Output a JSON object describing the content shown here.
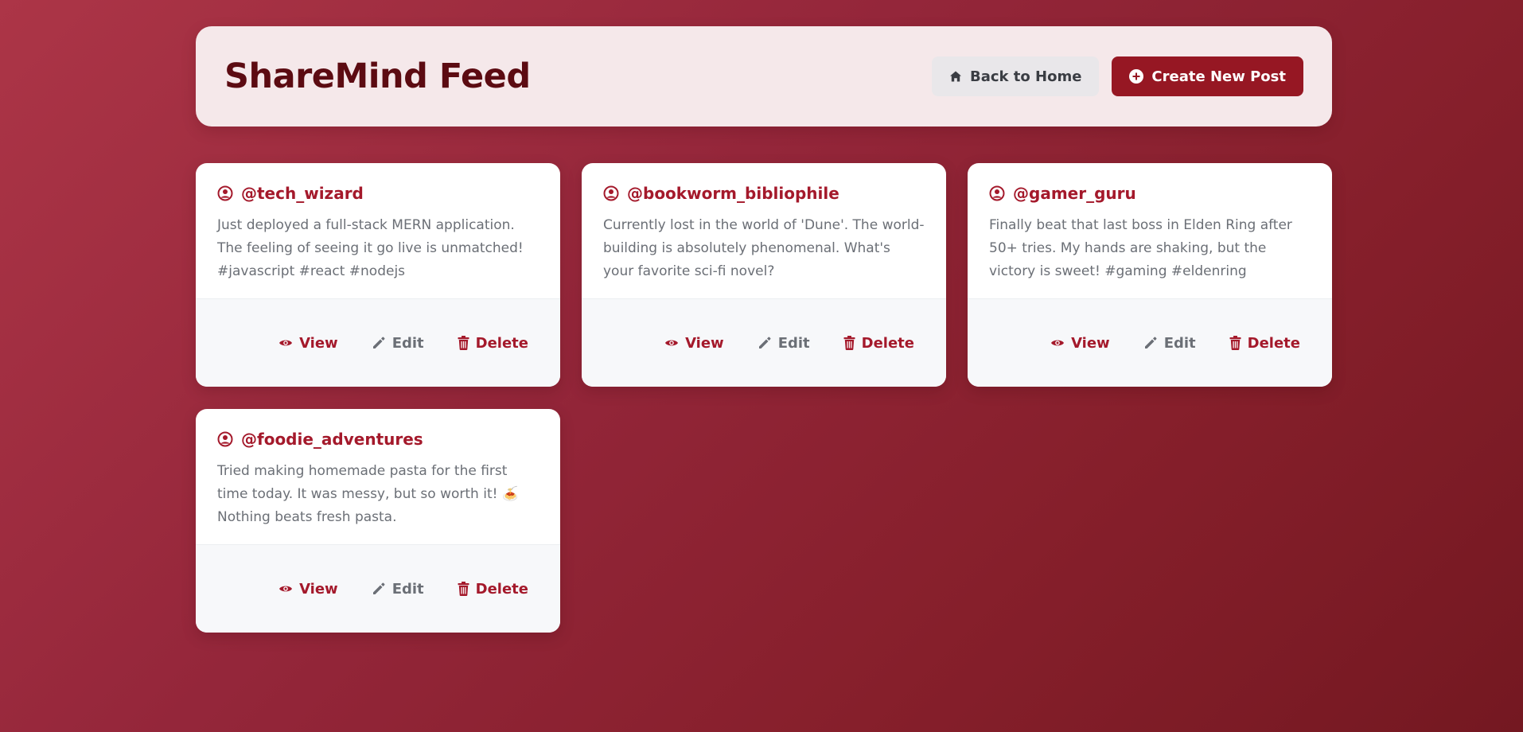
{
  "header": {
    "title": "ShareMind Feed",
    "back_label": "Back to Home",
    "create_label": "Create New Post"
  },
  "posts": [
    {
      "author": "@tech_wizard",
      "content": "Just deployed a full-stack MERN application. The feeling of seeing it go live is unmatched! #javascript #react #nodejs",
      "view_label": "View",
      "edit_label": "Edit",
      "delete_label": "Delete"
    },
    {
      "author": "@bookworm_bibliophile",
      "content": "Currently lost in the world of 'Dune'. The world-building is absolutely phenomenal. What's your favorite sci-fi novel?",
      "view_label": "View",
      "edit_label": "Edit",
      "delete_label": "Delete"
    },
    {
      "author": "@gamer_guru",
      "content": "Finally beat that last boss in Elden Ring after 50+ tries. My hands are shaking, but the victory is sweet! #gaming #eldenring",
      "view_label": "View",
      "edit_label": "Edit",
      "delete_label": "Delete"
    },
    {
      "author": "@foodie_adventures",
      "content": "Tried making homemade pasta for the first time today. It was messy, but so worth it! 🍝 Nothing beats fresh pasta.",
      "view_label": "View",
      "edit_label": "Edit",
      "delete_label": "Delete"
    }
  ],
  "icons": {
    "home": "home-icon",
    "create": "plus-circle-icon",
    "user": "user-circle-icon",
    "view": "eye-icon",
    "edit": "pencil-icon",
    "delete": "trash-icon"
  },
  "colors": {
    "accent": "#a4192b",
    "title": "#5c0b12",
    "create_button": "#961723",
    "background_start": "#ac3547",
    "background_end": "#741821"
  }
}
